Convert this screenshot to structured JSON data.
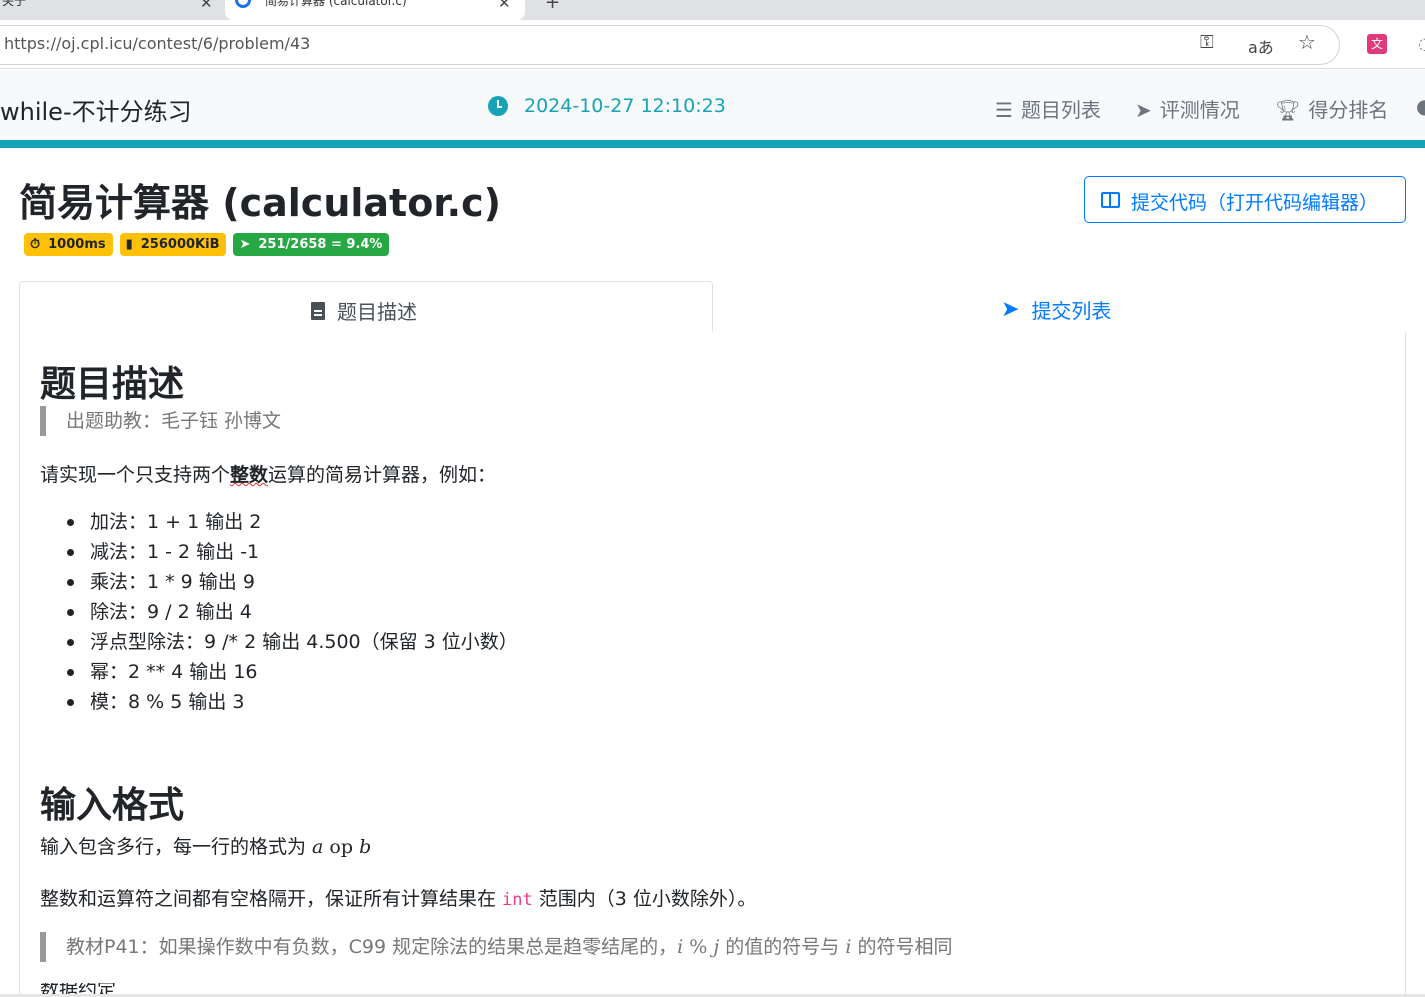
{
  "browser": {
    "tabs": [
      {
        "title": "关于",
        "close": "✕"
      },
      {
        "title": "简易计算器 (calculator.c)",
        "close": "✕"
      }
    ],
    "new_tab": "+",
    "url": "https://oj.cpl.icu/contest/6/problem/43",
    "icons": [
      "key-icon",
      "read-aloud-icon",
      "favorite-star-icon",
      "translate-extension-icon"
    ],
    "extension_label": "文A"
  },
  "navbar": {
    "brand": "while-不计分练习",
    "time": "2024-10-27 12:10:23",
    "items": [
      {
        "label": "题目列表",
        "icon": "list-icon"
      },
      {
        "label": "评测情况",
        "icon": "paper-plane-icon"
      },
      {
        "label": "得分排名",
        "icon": "trophy-icon"
      }
    ],
    "accent_color": "#17a2b8"
  },
  "problem": {
    "title": "简易计算器 (calculator.c)",
    "badges": [
      {
        "icon": "stopwatch-icon",
        "text": "1000ms",
        "color": "#ffc107"
      },
      {
        "icon": "memory-icon",
        "text": "256000KiB",
        "color": "#ffc107"
      },
      {
        "icon": "paper-plane-icon",
        "text": "251/2658 = 9.4%",
        "color": "#28a745"
      }
    ],
    "submit_label": "提交代码（打开代码编辑器）",
    "tabs": [
      {
        "label": "题目描述",
        "active": true
      },
      {
        "label": "提交列表",
        "active": false
      }
    ]
  },
  "content": {
    "desc_heading": "题目描述",
    "authors": "出题助教：毛子钰 孙博文",
    "intro_pre": "请实现一个只支持两个",
    "intro_bold": "整数",
    "intro_post": "运算的简易计算器，例如：",
    "examples": [
      "加法：1 + 1 输出 2",
      "减法：1 - 2 输出 -1",
      "乘法：1 * 9 输出 9",
      "除法：9 / 2 输出 4",
      "浮点型除法：9 /* 2 输出 4.500（保留 3 位小数）",
      "幂：2 ** 4 输出 16",
      "模：8 % 5 输出 3"
    ],
    "input_heading": "输入格式",
    "input_line_pre": "输入包含多行，每一行的格式为 ",
    "input_math_a": "a",
    "input_math_op": " op ",
    "input_math_b": "b",
    "range_pre": "整数和运算符之间都有空格隔开，保证所有计算结果在 ",
    "range_code": "int",
    "range_post": " 范围内（3 位小数除外）。",
    "note_pre": "教材P41：如果操作数中有负数，C99 规定除法的结果总是趋零结尾的，",
    "note_i": "i",
    "note_mod": " % ",
    "note_j": "j",
    "note_mid": " 的值的符号与 ",
    "note_i2": "i",
    "note_post": " 的符号相同",
    "cut_text": "数据约定"
  }
}
